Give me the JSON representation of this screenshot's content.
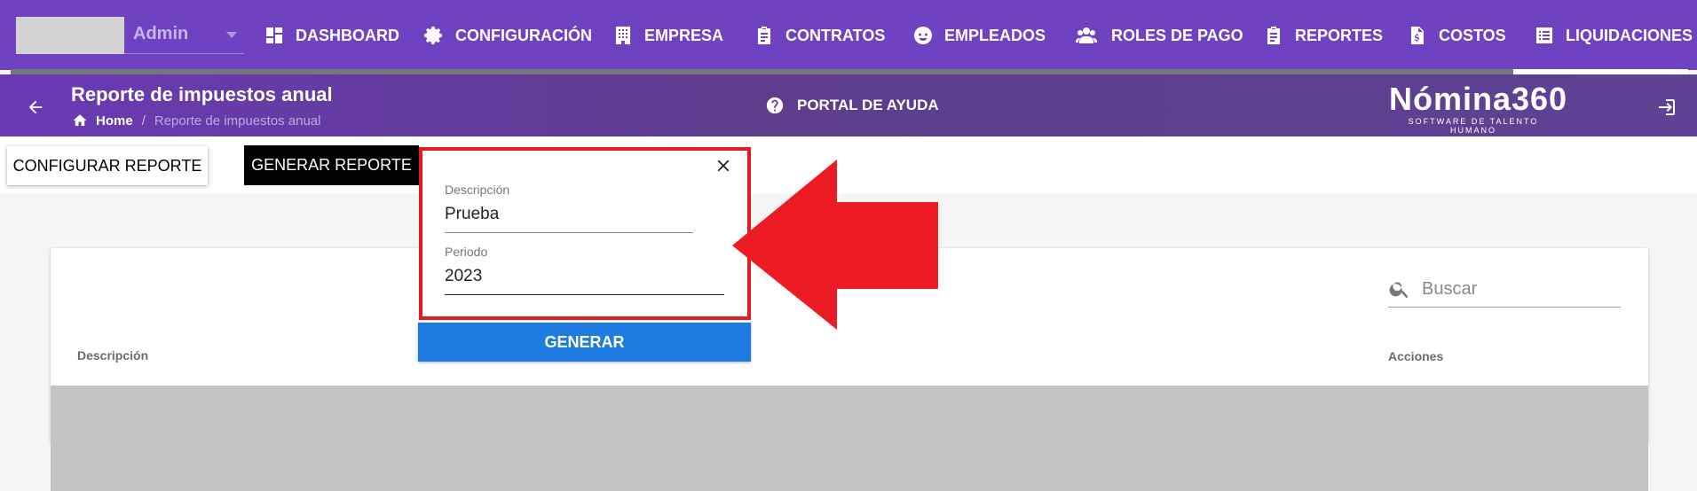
{
  "topbar": {
    "role": "Admin",
    "nav": [
      {
        "label": "DASHBOARD",
        "icon": "dashboard-icon"
      },
      {
        "label": "CONFIGURACIÓN",
        "icon": "gear-icon"
      },
      {
        "label": "EMPRESA",
        "icon": "building-icon"
      },
      {
        "label": "CONTRATOS",
        "icon": "clipboard-icon"
      },
      {
        "label": "EMPLEADOS",
        "icon": "face-icon"
      },
      {
        "label": "ROLES DE PAGO",
        "icon": "people-icon"
      },
      {
        "label": "REPORTES",
        "icon": "clipboard-icon"
      },
      {
        "label": "COSTOS",
        "icon": "file-dollar-icon"
      },
      {
        "label": "LIQUIDACIONES",
        "icon": "list-icon"
      }
    ]
  },
  "header": {
    "title": "Reporte de impuestos anual",
    "breadcrumb": {
      "home": "Home",
      "separator": "/",
      "current": "Reporte de impuestos anual"
    },
    "help": "PORTAL DE AYUDA",
    "brand": {
      "name": "Nómina360",
      "tagline": "SOFTWARE DE TALENTO HUMANO"
    }
  },
  "actions": {
    "configure": "CONFIGURAR REPORTE",
    "generate": "GENERAR REPORTE"
  },
  "table": {
    "search_placeholder": "Buscar",
    "columns": [
      "Descripción",
      "Acciones"
    ]
  },
  "popup": {
    "description_label": "Descripción",
    "description_value": "Prueba",
    "period_label": "Periodo",
    "period_value": "2023",
    "submit": "GENERAR"
  },
  "colors": {
    "topbar": "#6f42c1",
    "accent_blue": "#1e7be0",
    "highlight_red": "#e31c24"
  }
}
